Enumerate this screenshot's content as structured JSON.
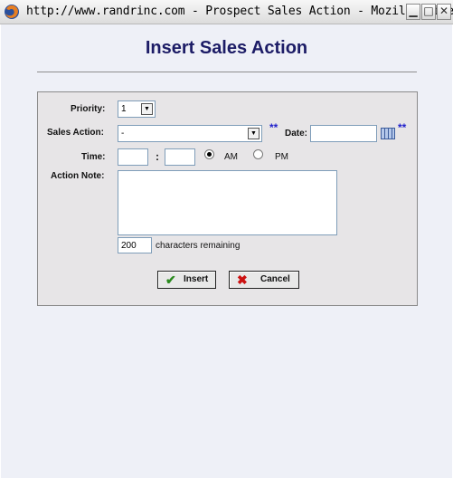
{
  "window": {
    "title": "http://www.randrinc.com - Prospect Sales Action - Mozilla Firefox",
    "controls": {
      "minimize": "▁",
      "maximize": "□",
      "close": "✕"
    }
  },
  "page": {
    "title": "Insert Sales Action"
  },
  "form": {
    "priority": {
      "label": "Priority:",
      "value": "1"
    },
    "sales_action": {
      "label": "Sales Action:",
      "value": "-",
      "required_mark": "**"
    },
    "date": {
      "label": "Date:",
      "value": "",
      "required_mark": "**",
      "icon": "calendar-icon"
    },
    "time": {
      "label": "Time:",
      "hour": "",
      "separator": ":",
      "minute": "",
      "am_label": "AM",
      "pm_label": "PM",
      "selected": "AM"
    },
    "action_note": {
      "label": "Action Note:",
      "value": ""
    },
    "char_counter": {
      "value": "200",
      "label": "characters remaining"
    },
    "buttons": {
      "insert": "Insert",
      "cancel": "Cancel"
    }
  },
  "colors": {
    "title": "#1c1c66",
    "required_mark": "#2222cc",
    "panel_bg": "#e7e5e7",
    "page_bg": "#eef0f7"
  }
}
